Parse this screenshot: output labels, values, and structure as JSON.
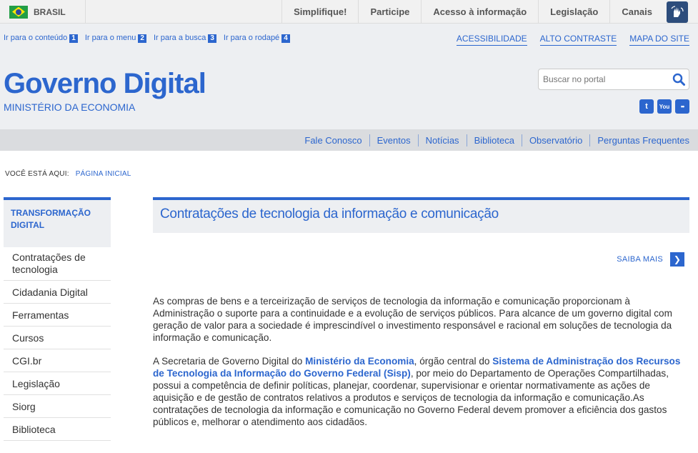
{
  "topbar": {
    "country_label": "BRASIL",
    "nav": [
      "Simplifique!",
      "Participe",
      "Acesso à informação",
      "Legislação",
      "Canais"
    ],
    "accessibility_icon": "hand-sign-icon"
  },
  "header": {
    "skip_links": [
      {
        "label": "Ir para o conteúdo",
        "key": "1"
      },
      {
        "label": "Ir para o menu",
        "key": "2"
      },
      {
        "label": "Ir para a busca",
        "key": "3"
      },
      {
        "label": "Ir para o rodapé",
        "key": "4"
      }
    ],
    "tools": [
      "ACESSIBILIDADE",
      "ALTO CONTRASTE",
      "MAPA DO SITE"
    ],
    "title": "Governo Digital",
    "subtitle": "MINISTÉRIO DA ECONOMIA",
    "search_placeholder": "Buscar no portal",
    "social": [
      "twitter-icon",
      "youtube-icon",
      "flickr-icon"
    ],
    "social_glyphs": [
      "t",
      "You",
      "••"
    ]
  },
  "service_nav": [
    "Fale Conosco",
    "Eventos",
    "Notícias",
    "Biblioteca",
    "Observatório",
    "Perguntas Frequentes"
  ],
  "breadcrumb": {
    "prefix": "VOCÊ ESTÁ AQUI:",
    "home": "PÁGINA INICIAL"
  },
  "sidebar": {
    "title": "TRANSFORMAÇÃO DIGITAL",
    "items": [
      "Contratações de tecnologia",
      "Cidadania Digital",
      "Ferramentas",
      "Cursos",
      "CGI.br",
      "Legislação",
      "Siorg",
      "Biblioteca"
    ]
  },
  "main": {
    "title": "Contratações de tecnologia da informação e comunicação",
    "saiba_mais": "SAIBA MAIS",
    "paragraph1": "As compras de bens e a terceirização de serviços de tecnologia da informação e comunicação proporcionam à Administração o suporte para a continuidade e a evolução de serviços públicos. Para alcance de um governo digital com geração de valor para a sociedade é imprescindível o investimento responsável e racional em soluções de tecnologia da informação e comunicação.",
    "paragraph2": {
      "part1": "A Secretaria de Governo Digital do ",
      "link1": "Ministério da Economia",
      "part2": ", órgão central do ",
      "link2": "Sistema de Administração dos Recursos de Tecnologia da Informação do Governo Federal (Sisp)",
      "part3": ", por meio do Departamento de Operações Compartilhadas, possui a competência de definir políticas, planejar, coordenar, supervisionar e orientar normativamente as ações de aquisição e de gestão de contratos relativos a produtos e serviços de tecnologia da informação e comunicação.As contratações de tecnologia da informação e comunicação no Governo Federal devem promover a eficiência dos gastos públicos e, melhorar o atendimento aos cidadãos."
    }
  },
  "colors": {
    "accent": "#2c66ce",
    "header_bg": "#edeff2",
    "nav_bg": "#dadcdf"
  }
}
